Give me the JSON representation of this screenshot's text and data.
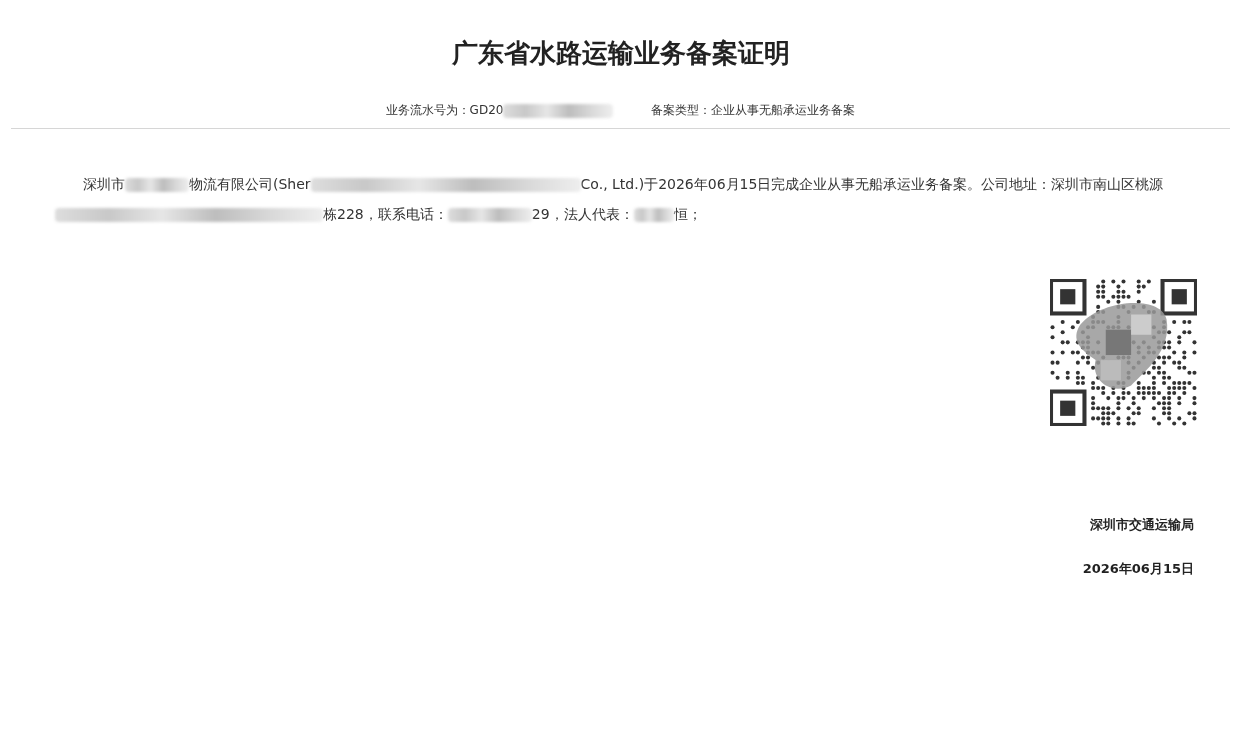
{
  "title": "广东省水路运输业务备案证明",
  "serial": {
    "text": "业务流水号为：GD20",
    "redacted": true
  },
  "filing_type": {
    "text": "备案类型：企业从事无船承运业务备案"
  },
  "statement": [
    {
      "kind": "text",
      "text": "深圳市"
    },
    {
      "kind": "redacted"
    },
    {
      "kind": "text",
      "text": "物流有限公司(Sher"
    },
    {
      "kind": "redacted"
    },
    {
      "kind": "text",
      "text": "Co., Ltd.)于2026年06月15日完成企业从事无船承运业务备案。公司地址：深圳市南山区桃源"
    },
    {
      "kind": "redacted"
    },
    {
      "kind": "text",
      "text": "栋228，联系电话："
    },
    {
      "kind": "redacted"
    },
    {
      "kind": "text",
      "text": "29，法人代表："
    },
    {
      "kind": "redacted"
    },
    {
      "kind": "text",
      "text": "恒；"
    }
  ],
  "issuer": "深圳市交通运输局",
  "date": "2026年06月15日"
}
